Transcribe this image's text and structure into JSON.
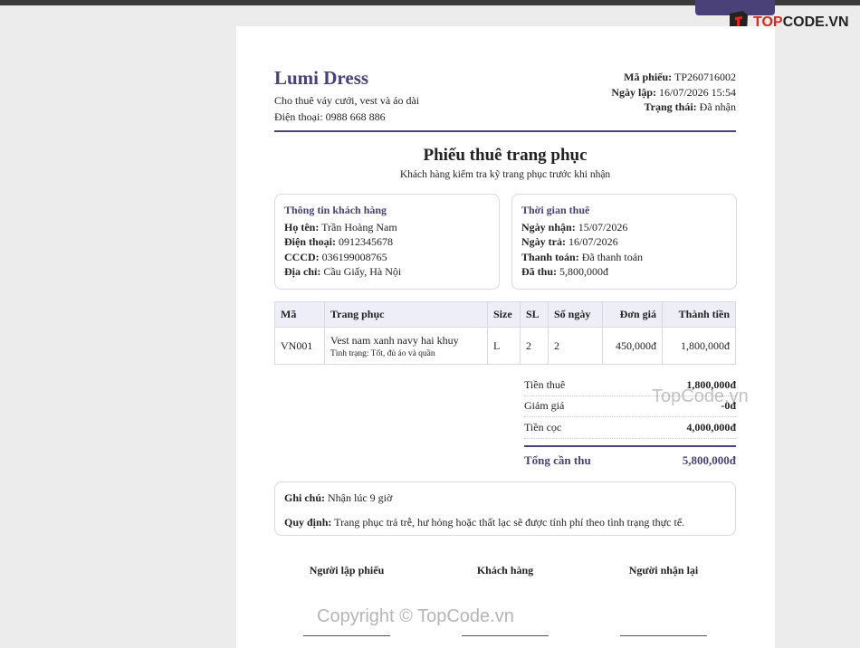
{
  "watermark": {
    "logo_text_a": "TOP",
    "logo_text_b": "CODE.VN",
    "mid_text": "TopCode.vn",
    "copyright_text": "Copyright © TopCode.vn"
  },
  "shop": {
    "name": "Lumi Dress",
    "tagline": "Cho thuê váy cưới, vest và áo dài",
    "phone_label": "Điện thoại:",
    "phone": "0988 668 886"
  },
  "receipt_meta": {
    "code_label": "Mã phiếu:",
    "code": "TP260716002",
    "created_label": "Ngày lập:",
    "created": "16/07/2026 15:54",
    "status_label": "Trạng thái:",
    "status": "Đã nhận"
  },
  "title": "Phiếu thuê trang phục",
  "subtitle": "Khách hàng kiểm tra kỹ trang phục trước khi nhận",
  "customer": {
    "heading": "Thông tin khách hàng",
    "name_label": "Họ tên:",
    "name": "Trần Hoàng Nam",
    "phone_label": "Điện thoại:",
    "phone": "0912345678",
    "id_label": "CCCD:",
    "id": "036199008765",
    "address_label": "Địa chỉ:",
    "address": "Cầu Giấy, Hà Nội"
  },
  "rental_time": {
    "heading": "Thời gian thuê",
    "pickup_label": "Ngày nhận:",
    "pickup": "15/07/2026",
    "return_label": "Ngày trả:",
    "return": "16/07/2026",
    "payment_label": "Thanh toán:",
    "payment": "Đã thanh toán",
    "paid_label": "Đã thu:",
    "paid": "5,800,000đ"
  },
  "items_table": {
    "headers": [
      "Mã",
      "Trang phục",
      "Size",
      "SL",
      "Số ngày",
      "Đơn giá",
      "Thành tiền"
    ],
    "rows": [
      {
        "code": "VN001",
        "name": "Vest nam xanh navy hai khuy",
        "condition": "Tình trạng: Tốt, đủ áo và quần",
        "size": "L",
        "qty": "2",
        "days": "2",
        "unit_price": "450,000đ",
        "amount": "1,800,000đ"
      }
    ]
  },
  "totals": {
    "rent_label": "Tiền thuê",
    "rent": "1,800,000đ",
    "discount_label": "Giảm giá",
    "discount": "-0đ",
    "deposit_label": "Tiền cọc",
    "deposit": "4,000,000đ",
    "grand_label": "Tổng cần thu",
    "grand": "5,800,000đ"
  },
  "notes": {
    "note_label": "Ghi chú:",
    "note": "Nhận lúc 9 giờ",
    "policy_label": "Quy định:",
    "policy": "Trang phục trả trễ, hư hỏng hoặc thất lạc sẽ được tính phí theo tình trạng thực tế."
  },
  "signatures": {
    "creator": "Người lập phiếu",
    "customer": "Khách hàng",
    "receiver": "Người nhận lại"
  },
  "colors": {
    "accent": "#4a4178",
    "table_header_bg": "#eeeef9",
    "page_bg": "#ececec",
    "logo_red": "#e0251b"
  }
}
